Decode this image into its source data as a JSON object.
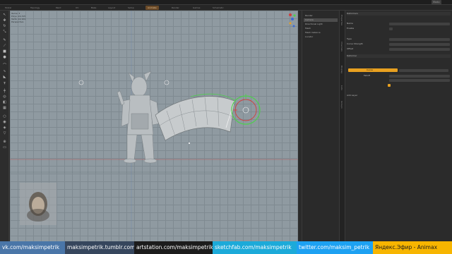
{
  "menubar": {
    "items": [
      "File",
      "Edit",
      "View",
      "Select",
      "Modes",
      "Texture",
      "Render",
      "Animate",
      "Layout",
      "System",
      "Help"
    ],
    "workspace_label": "Modo"
  },
  "tabs": [
    "Model",
    "Topology",
    "Paint",
    "UV",
    "Bake",
    "Layout",
    "Setup",
    "Animate",
    "Render",
    "Games",
    "Schematic"
  ],
  "active_tab": "Animate",
  "viewport": {
    "info_lines": [
      "Items: 3",
      "Polys: 24,315",
      "Verts: 12,104",
      "Perspective"
    ]
  },
  "outliner": {
    "rows": [
      "Render",
      "Camera",
      "Directional Light",
      "Mesh",
      "Mesh Instance",
      "Locator"
    ]
  },
  "side_strip": {
    "labels": [
      "Properties",
      "Channels",
      "Display",
      "Lists",
      "Groups"
    ]
  },
  "properties": {
    "header": "Deformers",
    "rows": [
      "Name",
      "Enable",
      "Type",
      "Curve Strength",
      "Offset",
      "Falloff"
    ],
    "section_label": "Deformer",
    "orange_label": "Curve",
    "footer_row": "Add Layer"
  },
  "colors": {
    "viewport_bg": "#8f9aa1",
    "accent_orange": "#e8a020",
    "gizmo_green": "#4fcf4f",
    "gizmo_red": "#d23c3c"
  },
  "footer": {
    "links": [
      {
        "text": "vk.com/maksimpetrik",
        "bg": "#4a76a8",
        "fg": "#ffffff"
      },
      {
        "text": "maksimpetrik.tumblr.com",
        "bg": "#36465d",
        "fg": "#ffffff"
      },
      {
        "text": "artstation.com/maksimpetrik",
        "bg": "#1c1c1c",
        "fg": "#ffffff"
      },
      {
        "text": "sketchfab.com/maksimpetrik",
        "bg": "#1caad9",
        "fg": "#ffffff"
      },
      {
        "text": "twitter.com/maksim_petrik",
        "bg": "#1da1f2",
        "fg": "#ffffff"
      },
      {
        "text": "Яндекс.Эфир - Animax",
        "bg": "#f7b500",
        "fg": "#1a1a1a"
      }
    ]
  }
}
